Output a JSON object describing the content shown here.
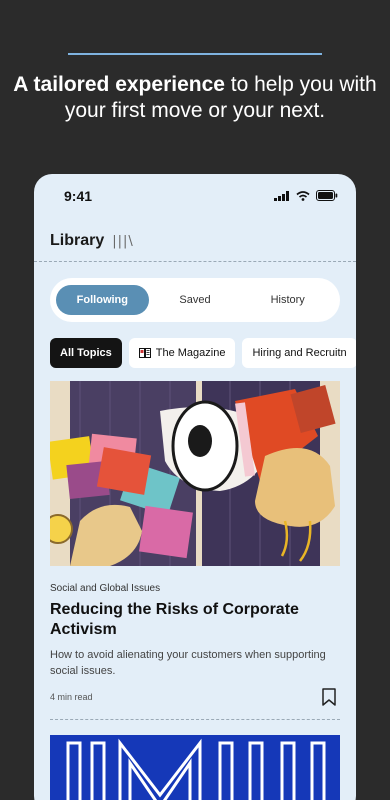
{
  "promo": {
    "headline_bold": "A tailored experience",
    "headline_rest": " to help you with your first move or your next."
  },
  "status_bar": {
    "time": "9:41",
    "icons": [
      "signal-icon",
      "wifi-icon",
      "battery-icon"
    ]
  },
  "library": {
    "title": "Library",
    "mark": "|||\\"
  },
  "tabs": [
    {
      "label": "Following",
      "active": true
    },
    {
      "label": "Saved",
      "active": false
    },
    {
      "label": "History",
      "active": false
    }
  ],
  "chips": [
    {
      "label": "All Topics",
      "active": true
    },
    {
      "label": "The Magazine",
      "icon": "magazine-icon"
    },
    {
      "label": "Hiring and Recruitn"
    }
  ],
  "article": {
    "category": "Social and Global Issues",
    "title": "Reducing the Risks of Corporate Activism",
    "dek": "How to avoid alienating your customers when supporting social issues.",
    "read_time": "4 min read",
    "bookmark_icon": "bookmark-icon"
  },
  "colors": {
    "accent": "#5a8fb4",
    "background": "#2b2b2b",
    "phone_bg": "#e3eef8",
    "rule": "#7fb3e0"
  }
}
